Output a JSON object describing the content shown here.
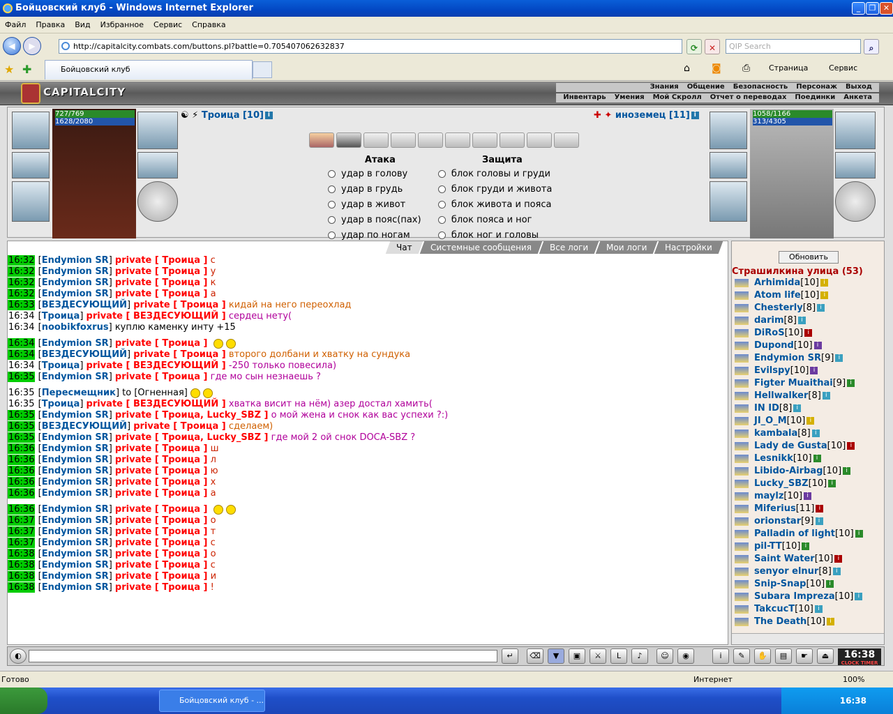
{
  "window": {
    "title": "Бойцовский клуб - Windows Internet Explorer"
  },
  "menu": [
    "Файл",
    "Правка",
    "Вид",
    "Избранное",
    "Сервис",
    "Справка"
  ],
  "address": {
    "url": "http://capitalcity.combats.com/buttons.pl?battle=0.705407062632837"
  },
  "search": {
    "placeholder": "QIP Search"
  },
  "tab": {
    "title": "Бойцовский клуб"
  },
  "toolbar_right": {
    "page": "Страница",
    "service": "Сервис"
  },
  "game": {
    "logo": "CAPITALCITY",
    "topmenu_row1": [
      "Знания",
      "Общение",
      "Безопасность",
      "Персонаж",
      "Выход"
    ],
    "topmenu_row2": [
      "Инвентарь",
      "Умения",
      "Мой Скролл",
      "Отчет о переводах",
      "Поединки",
      "Анкета"
    ],
    "me": {
      "name": "Троица [10]",
      "hp": "727/769",
      "mana": "1628/2080"
    },
    "enemy": {
      "name": "иноземец [11]",
      "hp": "1058/1166",
      "mana": "313/4305"
    },
    "attack_title": "Атака",
    "defense_title": "Защита",
    "attacks": [
      "удар в голову",
      "удар в грудь",
      "удар в живот",
      "удар в пояс(пах)",
      "удар по ногам"
    ],
    "defenses": [
      "блок головы и груди",
      "блок груди и живота",
      "блок живота и пояса",
      "блок пояса и ног",
      "блок ног и головы"
    ],
    "chat_tabs": [
      "Чат",
      "Системные сообщения",
      "Все логи",
      "Мои логи",
      "Настройки"
    ]
  },
  "chat": [
    {
      "t": "16:32",
      "hl": true,
      "u": "Endymion SR",
      "p": "private [ Троица ]",
      "m": "с",
      "c": "m-r"
    },
    {
      "t": "16:32",
      "hl": true,
      "u": "Endymion SR",
      "p": "private [ Троица ]",
      "m": "у",
      "c": "m-r"
    },
    {
      "t": "16:32",
      "hl": true,
      "u": "Endymion SR",
      "p": "private [ Троица ]",
      "m": "к",
      "c": "m-r"
    },
    {
      "t": "16:32",
      "hl": true,
      "u": "Endymion SR",
      "p": "private [ Троица ]",
      "m": "а",
      "c": "m-r"
    },
    {
      "t": "16:33",
      "hl": true,
      "u": "ВЕЗДЕСУЮЩИЙ",
      "p": "private [ Троица ]",
      "m": "кидай на него переохлад",
      "c": "m-o"
    },
    {
      "t": "16:34",
      "hl": false,
      "u": "Троица",
      "p": "private [ ВЕЗДЕСУЮЩИЙ ]",
      "m": "сердец нету(",
      "c": "m-p"
    },
    {
      "t": "16:34",
      "hl": false,
      "u": "noobikfoxrus",
      "p": "",
      "m": "куплю каменку инту +15",
      "c": "m-k"
    },
    {
      "t": "16:34",
      "hl": true,
      "u": "Endymion SR",
      "p": "private [ Троица ]",
      "m": "",
      "c": "m-r",
      "smile": true,
      "gap": true
    },
    {
      "t": "16:34",
      "hl": true,
      "u": "ВЕЗДЕСУЮЩИЙ",
      "p": "private [ Троица ]",
      "m": "второго долбани и хватку на сундука",
      "c": "m-o"
    },
    {
      "t": "16:34",
      "hl": false,
      "u": "Троица",
      "p": "private [ ВЕЗДЕСУЮЩИЙ ]",
      "m": "-250 только повесила)",
      "c": "m-p"
    },
    {
      "t": "16:35",
      "hl": true,
      "u": "Endymion SR",
      "p": "private [ Троица ]",
      "m": "где мо сын незнаешь ?",
      "c": "m-p"
    },
    {
      "t": "16:35",
      "hl": false,
      "u": "Пересмещник",
      "p": "",
      "m": "to [Огненная]",
      "c": "m-k",
      "smile": true,
      "gap": true
    },
    {
      "t": "16:35",
      "hl": false,
      "u": "Троица",
      "p": "private [ ВЕЗДЕСУЮЩИЙ ]",
      "m": "хватка висит на нём) азер достал хамить(",
      "c": "m-p"
    },
    {
      "t": "16:35",
      "hl": true,
      "u": "Endymion SR",
      "p": "private [ Троица, Lucky_SBZ ]",
      "m": "о мой жена и снок как вас успехи ?:)",
      "c": "m-p"
    },
    {
      "t": "16:35",
      "hl": true,
      "u": "ВЕЗДЕСУЮЩИЙ",
      "p": "private [ Троица ]",
      "m": "сделаем)",
      "c": "m-o"
    },
    {
      "t": "16:35",
      "hl": true,
      "u": "Endymion SR",
      "p": "private [ Троица, Lucky_SBZ ]",
      "m": "где мой 2 ой снок DOCA-SBZ ?",
      "c": "m-p"
    },
    {
      "t": "16:36",
      "hl": true,
      "u": "Endymion SR",
      "p": "private [ Троица ]",
      "m": "ш",
      "c": "m-r"
    },
    {
      "t": "16:36",
      "hl": true,
      "u": "Endymion SR",
      "p": "private [ Троица ]",
      "m": "л",
      "c": "m-r"
    },
    {
      "t": "16:36",
      "hl": true,
      "u": "Endymion SR",
      "p": "private [ Троица ]",
      "m": "ю",
      "c": "m-r"
    },
    {
      "t": "16:36",
      "hl": true,
      "u": "Endymion SR",
      "p": "private [ Троица ]",
      "m": "х",
      "c": "m-r"
    },
    {
      "t": "16:36",
      "hl": true,
      "u": "Endymion SR",
      "p": "private [ Троица ]",
      "m": "а",
      "c": "m-r"
    },
    {
      "t": "16:36",
      "hl": true,
      "u": "Endymion SR",
      "p": "private [ Троица ]",
      "m": "",
      "c": "m-r",
      "smile": true,
      "gap": true
    },
    {
      "t": "16:37",
      "hl": true,
      "u": "Endymion SR",
      "p": "private [ Троица ]",
      "m": "о",
      "c": "m-r"
    },
    {
      "t": "16:37",
      "hl": true,
      "u": "Endymion SR",
      "p": "private [ Троица ]",
      "m": "т",
      "c": "m-r"
    },
    {
      "t": "16:37",
      "hl": true,
      "u": "Endymion SR",
      "p": "private [ Троица ]",
      "m": "с",
      "c": "m-r"
    },
    {
      "t": "16:38",
      "hl": true,
      "u": "Endymion SR",
      "p": "private [ Троица ]",
      "m": "о",
      "c": "m-r"
    },
    {
      "t": "16:38",
      "hl": true,
      "u": "Endymion SR",
      "p": "private [ Троица ]",
      "m": "с",
      "c": "m-r"
    },
    {
      "t": "16:38",
      "hl": true,
      "u": "Endymion SR",
      "p": "private [ Троица ]",
      "m": "и",
      "c": "m-r"
    },
    {
      "t": "16:38",
      "hl": true,
      "u": "Endymion SR",
      "p": "private [ Троица ]",
      "m": "!",
      "c": "m-r"
    }
  ],
  "online": {
    "refresh": "Обновить",
    "room": "Страшилкина улица (53)",
    "users": [
      {
        "n": "Arhimida",
        "l": "[10]",
        "i": "y"
      },
      {
        "n": "Atom life",
        "l": "[10]",
        "i": "y"
      },
      {
        "n": "Chesterly",
        "l": "[8]",
        "i": "c"
      },
      {
        "n": "darim",
        "l": "[8]",
        "i": "c"
      },
      {
        "n": "DiRoS",
        "l": "[10]",
        "i": "r"
      },
      {
        "n": "Dupond",
        "l": "[10]",
        "i": "p"
      },
      {
        "n": "Endymion SR",
        "l": "[9]",
        "i": "c"
      },
      {
        "n": "Evilspy",
        "l": "[10]",
        "i": "p"
      },
      {
        "n": "Figter Muaithai",
        "l": "[9]",
        "i": "g"
      },
      {
        "n": "Hellwalker",
        "l": "[8]",
        "i": "c"
      },
      {
        "n": "IN ID",
        "l": "[8]",
        "i": "c"
      },
      {
        "n": "JI_O_M",
        "l": "[10]",
        "i": "y"
      },
      {
        "n": "kambala",
        "l": "[8]",
        "i": "c"
      },
      {
        "n": "Lady de Gusta",
        "l": "[10]",
        "i": "r"
      },
      {
        "n": "Lesnikk",
        "l": "[10]",
        "i": "g"
      },
      {
        "n": "Libido-Airbag",
        "l": "[10]",
        "i": "g"
      },
      {
        "n": "Lucky_SBZ",
        "l": "[10]",
        "i": "g"
      },
      {
        "n": "maylz",
        "l": "[10]",
        "i": "p"
      },
      {
        "n": "Miferius",
        "l": "[11]",
        "i": "r"
      },
      {
        "n": "orionstar",
        "l": "[9]",
        "i": "c"
      },
      {
        "n": "Palladin of light",
        "l": "[10]",
        "i": "g"
      },
      {
        "n": "pil-TT",
        "l": "[10]",
        "i": "g"
      },
      {
        "n": "Saint Water",
        "l": "[10]",
        "i": "r"
      },
      {
        "n": "senyor elnur",
        "l": "[8]",
        "i": "c"
      },
      {
        "n": "Snip-Snap",
        "l": "[10]",
        "i": "g"
      },
      {
        "n": "Subara Impreza",
        "l": "[10]",
        "i": "c"
      },
      {
        "n": "TakcucT",
        "l": "[10]",
        "i": "c"
      },
      {
        "n": "The Death",
        "l": "[10]",
        "i": "y"
      }
    ]
  },
  "clock": {
    "time": "16:38",
    "sub": "CLOCK TIMER"
  },
  "status": {
    "left": "Готово",
    "zone": "Интернет",
    "zoom": "100%"
  },
  "taskbar": {
    "task": "Бойцовский клуб - ...",
    "time": "16:38"
  }
}
